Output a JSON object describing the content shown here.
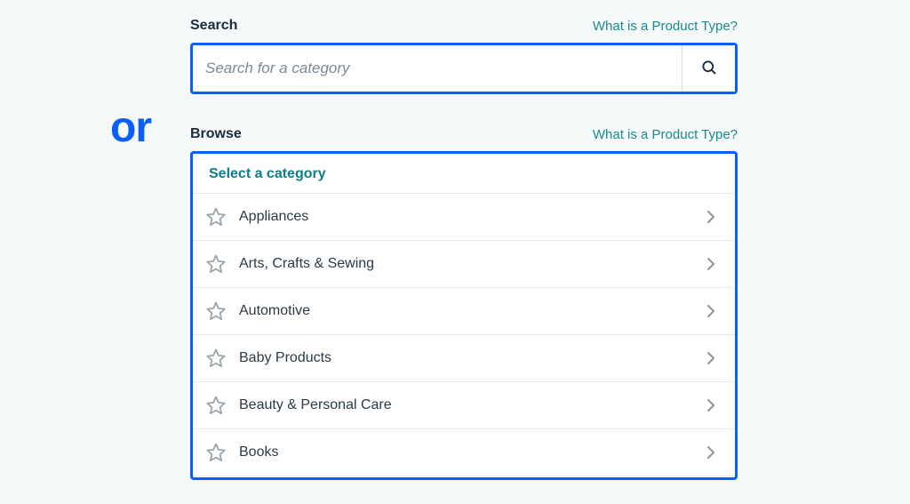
{
  "or_label": "or",
  "search": {
    "title": "Search",
    "help_link": "What is a Product Type?",
    "placeholder": "Search for a category"
  },
  "browse": {
    "title": "Browse",
    "help_link": "What is a Product Type?",
    "select_header": "Select a category",
    "categories": [
      "Appliances",
      "Arts, Crafts & Sewing",
      "Automotive",
      "Baby Products",
      "Beauty & Personal Care",
      "Books"
    ]
  }
}
